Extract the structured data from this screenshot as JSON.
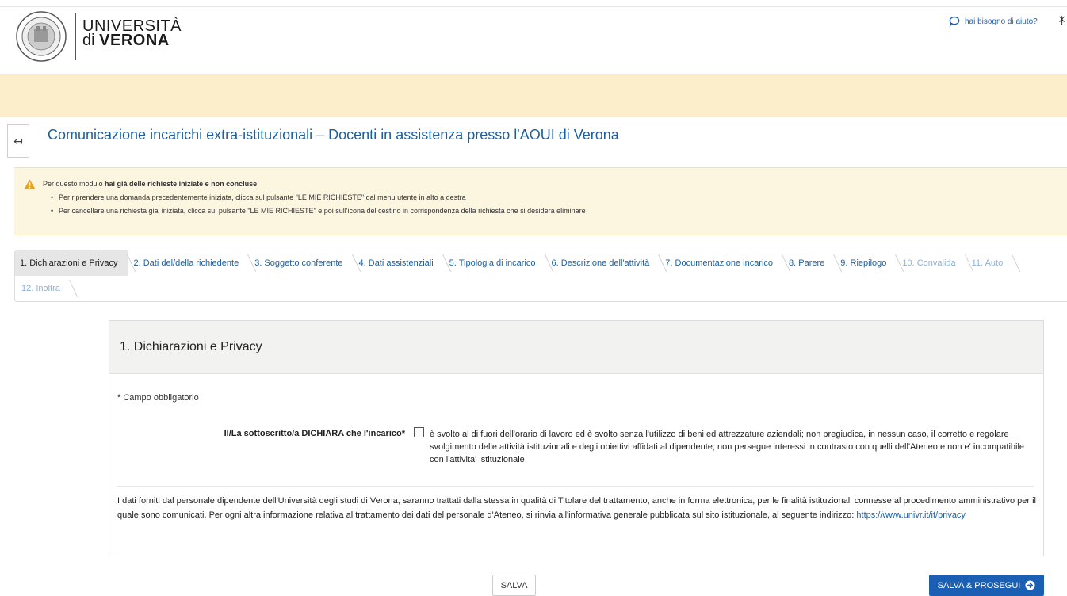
{
  "header": {
    "logo_line1": "UNIVERSITÀ",
    "logo_line2_prefix": "di",
    "logo_line2_bold": "VERONA",
    "help_label": "hai bisogno di aiuto?",
    "user_icon": "user-icon"
  },
  "title": {
    "back_icon": "arrow-left-icon",
    "text": "Comunicazione incarichi extra-istituzionali – Docenti in assistenza presso l'AOUI di Verona"
  },
  "warning": {
    "prefix": "Per questo modulo ",
    "bold": "hai già delle richieste iniziate e non concluse",
    "suffix": ":",
    "items": [
      "Per riprendere una domanda precedentemente iniziata, clicca sul pulsante \"LE MIE RICHIESTE\" dal menu utente in alto a destra",
      "Per cancellare una richiesta gia' iniziata, clicca sul pulsante \"LE MIE RICHIESTE\" e poi sull'icona del cestino in corrispondenza della richiesta che si desidera eliminare"
    ]
  },
  "steps": [
    {
      "label": "1. Dichiarazioni e Privacy",
      "state": "active"
    },
    {
      "label": "2. Dati del/della richiedente",
      "state": "enabled"
    },
    {
      "label": "3. Soggetto conferente",
      "state": "enabled"
    },
    {
      "label": "4. Dati assistenziali",
      "state": "enabled"
    },
    {
      "label": "5. Tipologia di incarico",
      "state": "enabled"
    },
    {
      "label": "6. Descrizione dell'attività",
      "state": "enabled"
    },
    {
      "label": "7. Documentazione incarico",
      "state": "enabled"
    },
    {
      "label": "8. Parere",
      "state": "enabled"
    },
    {
      "label": "9. Riepilogo",
      "state": "enabled"
    },
    {
      "label": "10. Convalida",
      "state": "disabled"
    },
    {
      "label": "11. Auto",
      "state": "disabled"
    },
    {
      "label": "12. Inoltra",
      "state": "disabled"
    }
  ],
  "card": {
    "title": "1. Dichiarazioni e Privacy",
    "required_note": "* Campo obbligatorio",
    "declare_label": "Il/La sottoscritto/a DICHIARA che l'incarico*",
    "declare_checked": false,
    "declare_text": "è svolto al di fuori dell'orario di lavoro ed è svolto senza l'utilizzo di beni ed attrezzature aziendali; non pregiudica, in nessun caso, il corretto e regolare svolgimento delle attività istituzionali e degli obiettivi affidati al dipendente; non persegue interessi in contrasto con quelli dell'Ateneo e non e' incompatibile con l'attivita' istituzionale",
    "privacy_text": "I dati forniti dal personale dipendente dell'Università degli studi di Verona, saranno trattati dalla stessa in qualità di Titolare del trattamento, anche in forma elettronica, per le finalità istituzionali connesse al procedimento amministrativo per il quale sono comunicati. Per ogni altra informazione relativa al trattamento dei dati del personale d'Ateneo, si rinvia all'informativa generale pubblicata sul sito istituzionale, al seguente indirizzo: ",
    "privacy_link": "https://www.univr.it/it/privacy"
  },
  "buttons": {
    "save": "SALVA",
    "save_next": "SALVA & PROSEGUI",
    "save_next_icon": "arrow-circle-right-icon"
  },
  "colors": {
    "accent": "#1a5fb4",
    "title_blue": "#1d5f9e",
    "yellow_band": "#fdeecb",
    "warning_bg": "#fcf5e0",
    "warning_icon": "#e8a317"
  }
}
